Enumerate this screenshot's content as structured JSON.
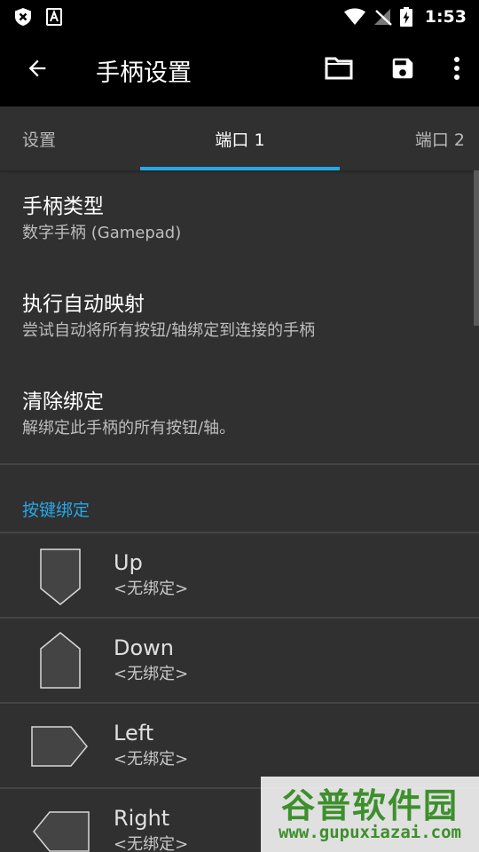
{
  "status_bar": {
    "time": "1:53",
    "icons": [
      "shield-x-icon",
      "font-a-icon",
      "wifi-icon",
      "no-signal-icon",
      "battery-charging-icon"
    ]
  },
  "toolbar": {
    "title": "手柄设置",
    "back_icon": "arrow-left-icon",
    "folder_icon": "folder-icon",
    "save_icon": "save-icon",
    "more_icon": "more-vertical-icon"
  },
  "tabs": [
    {
      "label": "设置",
      "selected": false
    },
    {
      "label": "端口 1",
      "selected": true
    },
    {
      "label": "端口 2",
      "selected": false
    }
  ],
  "preferences": [
    {
      "title": "手柄类型",
      "summary": "数字手柄 (Gamepad)"
    },
    {
      "title": "执行自动映射",
      "summary": "尝试自动将所有按钮/轴绑定到连接的手柄"
    },
    {
      "title": "清除绑定",
      "summary": "解绑定此手柄的所有按钮/轴。"
    }
  ],
  "category": "按键绑定",
  "bindings": [
    {
      "name": "Up",
      "value": "<无绑定>",
      "icon": "dpad-up-icon"
    },
    {
      "name": "Down",
      "value": "<无绑定>",
      "icon": "dpad-down-icon"
    },
    {
      "name": "Left",
      "value": "<无绑定>",
      "icon": "dpad-left-icon"
    },
    {
      "name": "Right",
      "value": "<无绑定>",
      "icon": "dpad-right-icon"
    }
  ],
  "watermark": {
    "title": "谷普软件园",
    "url": "www.gupuxiazai.com"
  },
  "colors": {
    "accent": "#26a8e8",
    "background": "#303030",
    "toolbar": "#000000",
    "divider": "#454545",
    "watermark": "#3d8f2c"
  }
}
